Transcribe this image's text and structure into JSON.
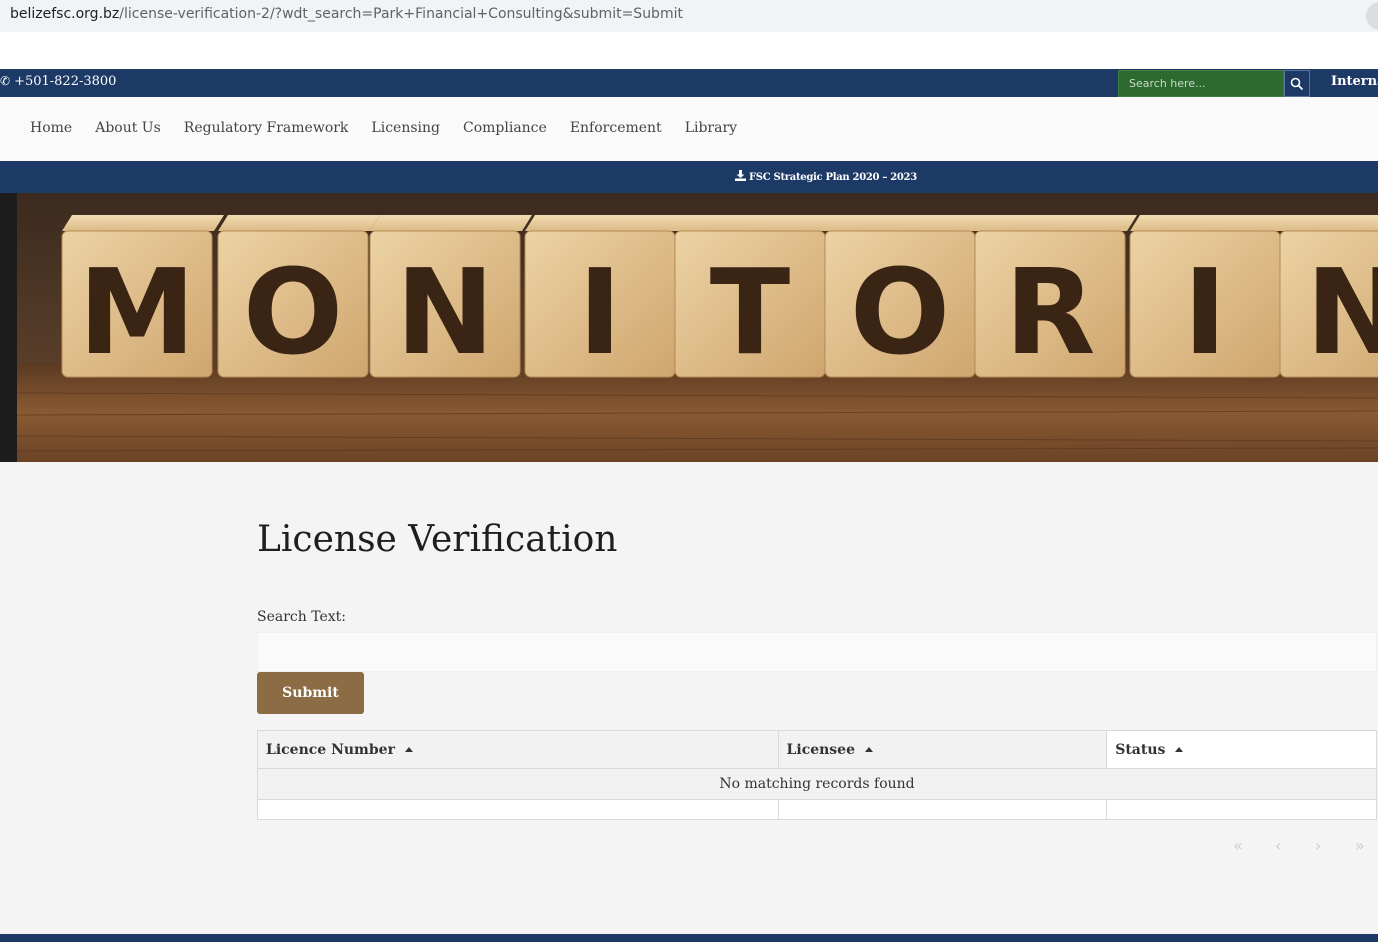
{
  "browser": {
    "url_host": "belizefsc.org.bz",
    "url_path": "/license-verification-2/?wdt_search=Park+Financial+Consulting&submit=Submit"
  },
  "topbar": {
    "phone": "+501-822-3800",
    "search_placeholder": "Search here...",
    "intl_label": "Internat"
  },
  "nav": {
    "items": [
      {
        "label": "Home"
      },
      {
        "label": "About Us"
      },
      {
        "label": "Regulatory Framework"
      },
      {
        "label": "Licensing"
      },
      {
        "label": "Compliance"
      },
      {
        "label": "Enforcement"
      },
      {
        "label": "Library"
      }
    ]
  },
  "plan_bar": {
    "link_label": "FSC Strategic Plan 2020 – 2023"
  },
  "hero": {
    "letters": [
      "M",
      "O",
      "N",
      "I",
      "T",
      "O",
      "R",
      "I",
      "N"
    ]
  },
  "content": {
    "title": "License Verification",
    "search_label": "Search Text:",
    "search_value": "",
    "submit_label": "Submit"
  },
  "table": {
    "columns": [
      {
        "label": "Licence Number"
      },
      {
        "label": "Licensee"
      },
      {
        "label": "Status"
      }
    ],
    "empty_message": "No matching records found"
  },
  "pagination": {
    "first": "«",
    "prev": "‹",
    "next": "›",
    "last": "»"
  },
  "colors": {
    "navy": "#1d3a66",
    "search_green": "#2d6a2f",
    "button_brown": "#8b6c45"
  }
}
